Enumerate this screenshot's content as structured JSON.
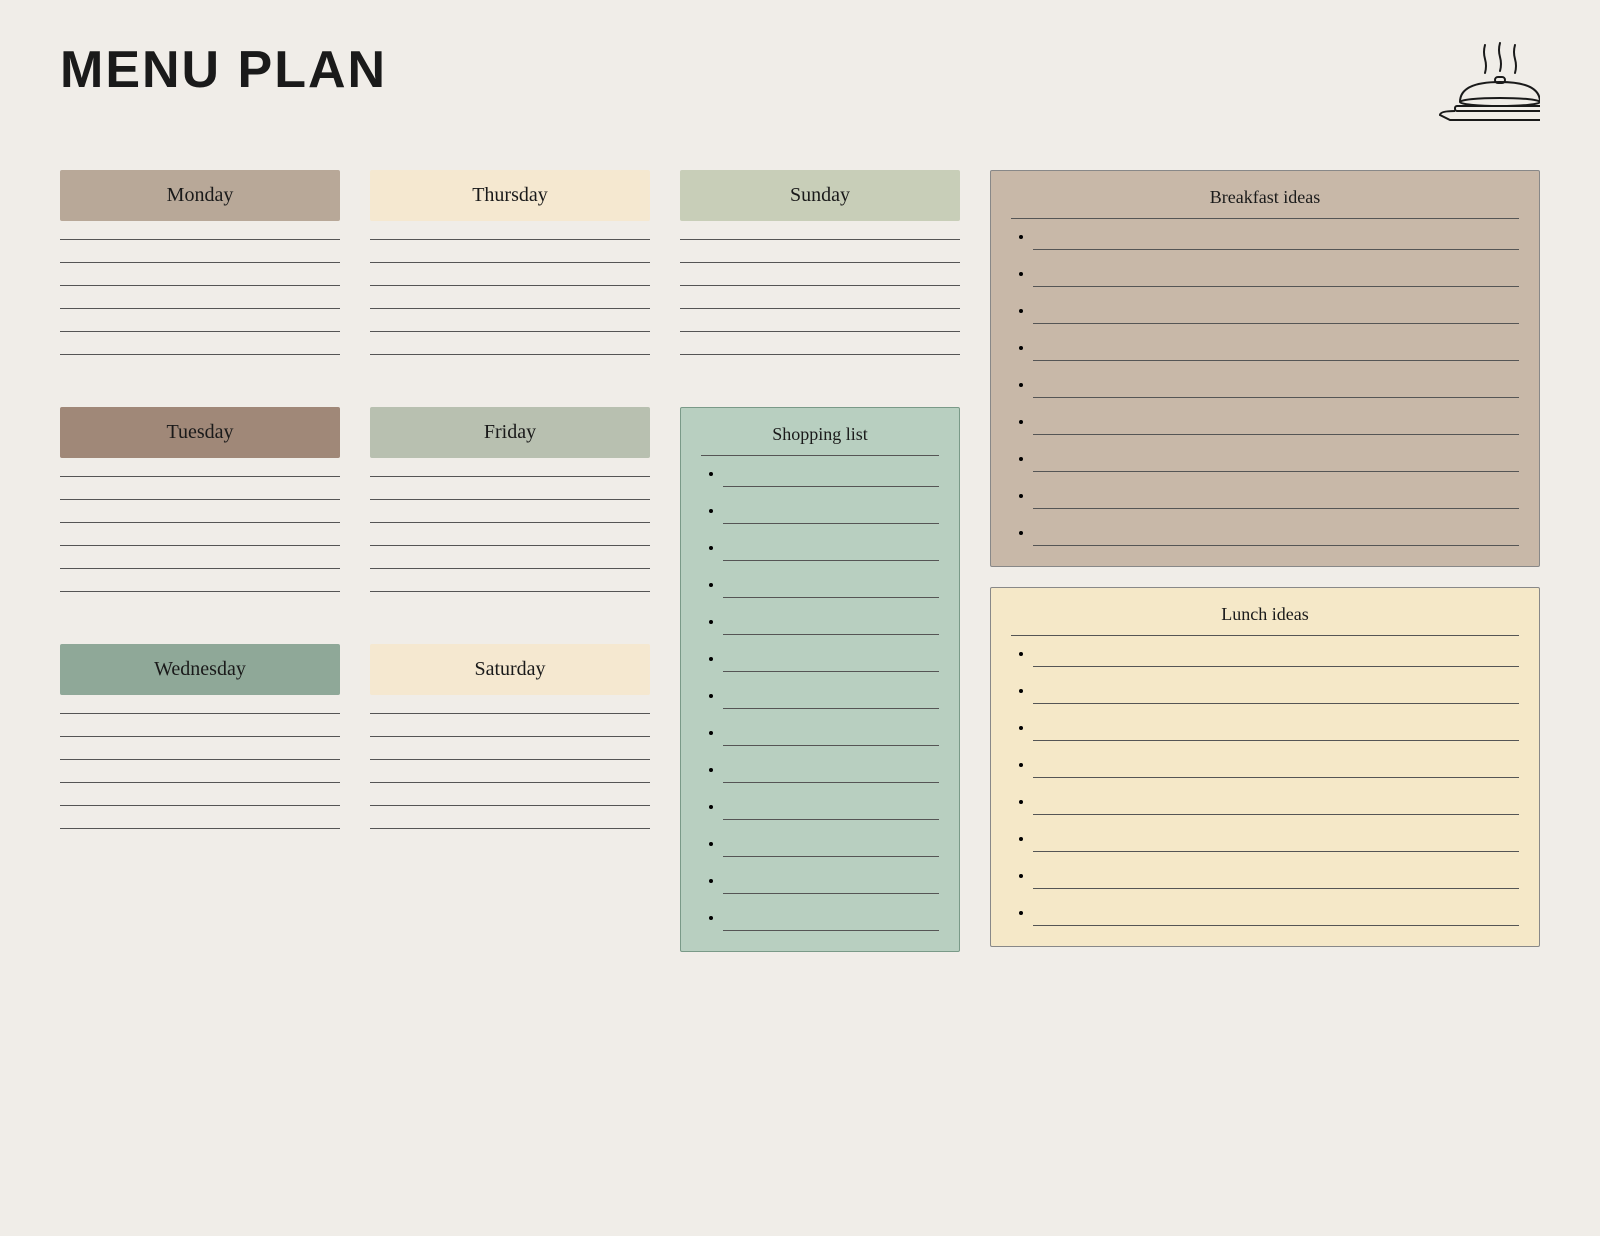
{
  "page": {
    "title": "MENU PLAN"
  },
  "days": {
    "monday": {
      "label": "Monday",
      "color_class": "monday-label",
      "lines": 6
    },
    "tuesday": {
      "label": "Tuesday",
      "color_class": "tuesday-label",
      "lines": 6
    },
    "wednesday": {
      "label": "Wednesday",
      "color_class": "wednesday-label",
      "lines": 6
    },
    "thursday": {
      "label": "Thursday",
      "color_class": "thursday-label",
      "lines": 6
    },
    "friday": {
      "label": "Friday",
      "color_class": "friday-label",
      "lines": 6
    },
    "saturday": {
      "label": "Saturday",
      "color_class": "saturday-label",
      "lines": 6
    },
    "sunday": {
      "label": "Sunday",
      "color_class": "sunday-label",
      "lines": 6
    }
  },
  "shopping_list": {
    "title": "Shopping list",
    "items": 13
  },
  "breakfast_ideas": {
    "title": "Breakfast ideas",
    "items": 9
  },
  "lunch_ideas": {
    "title": "Lunch ideas",
    "items": 8
  }
}
